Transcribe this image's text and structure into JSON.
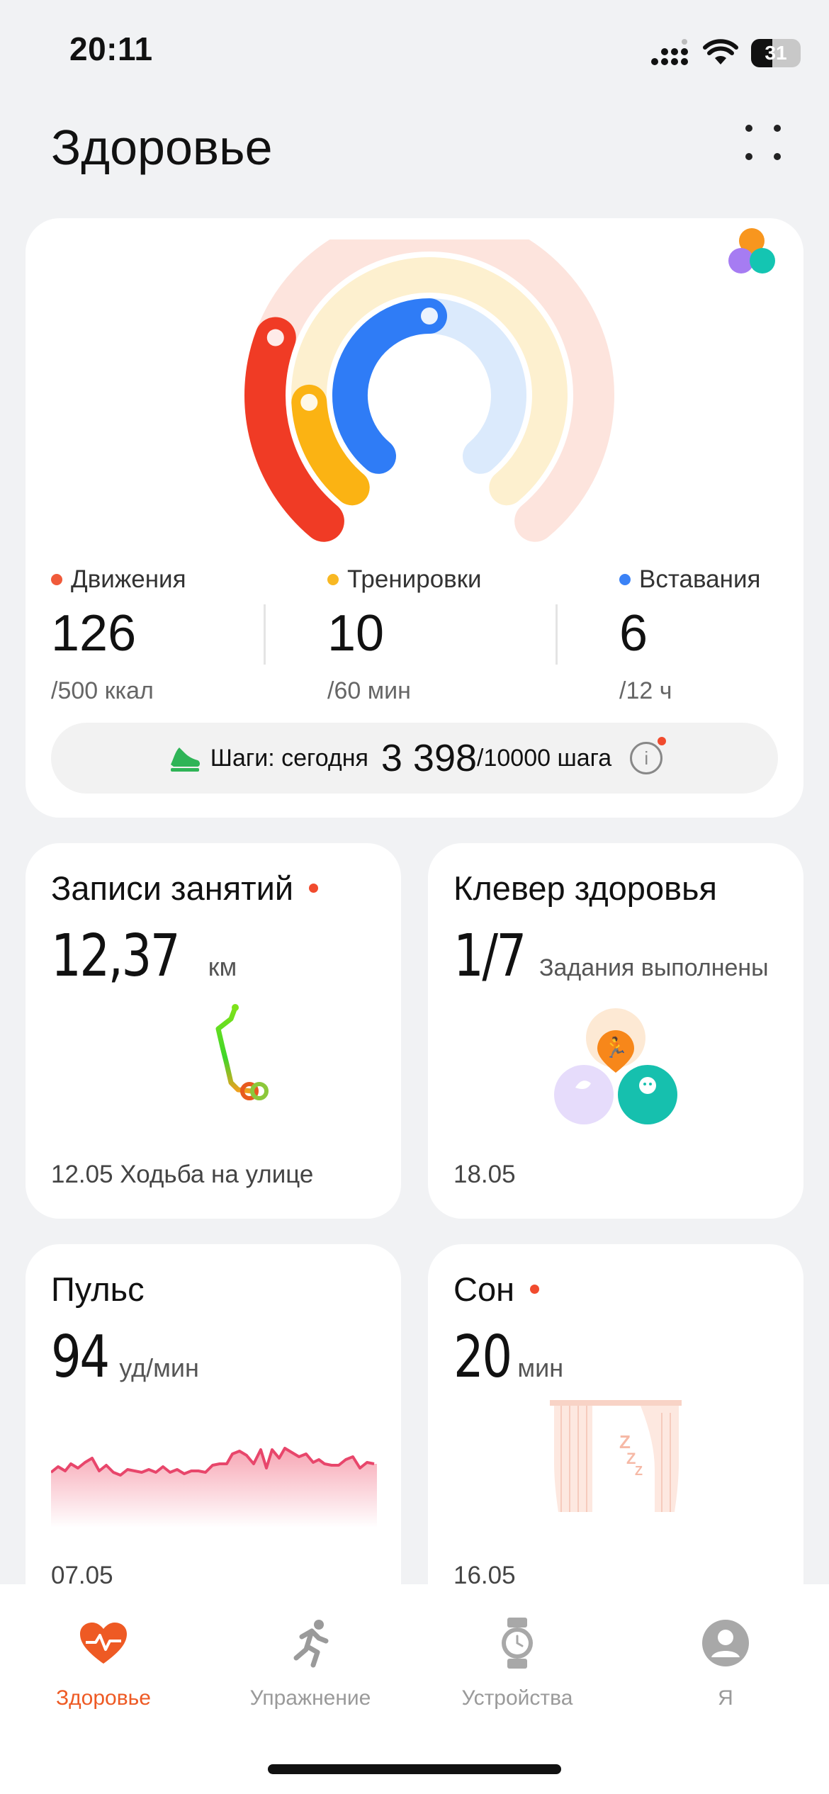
{
  "status_bar": {
    "time": "20:11",
    "battery": "31"
  },
  "page": {
    "title": "Здоровье"
  },
  "activity": {
    "rings": [
      {
        "name": "Движения",
        "value": 126,
        "goal": 500,
        "color": "#f03b25"
      },
      {
        "name": "Тренировки",
        "value": 10,
        "goal": 60,
        "color": "#fbb313"
      },
      {
        "name": "Вставания",
        "value": 6,
        "goal": 12,
        "color": "#2f7cf6"
      }
    ],
    "metrics": [
      {
        "label": "Движения",
        "value": "126",
        "goal": "/500 ккал",
        "color": "#f05a3a"
      },
      {
        "label": "Тренировки",
        "value": "10",
        "goal": "/60 мин",
        "color": "#f8b823"
      },
      {
        "label": "Вставания",
        "value": "6",
        "goal": "/12 ч",
        "color": "#3b82f6"
      }
    ],
    "steps": {
      "label": "Шаги: сегодня",
      "value": "3 398",
      "goal": "/10000 шага"
    }
  },
  "cards": {
    "workouts": {
      "title": "Записи занятий",
      "value": "12,37",
      "unit": "км",
      "footer": "12.05 Ходьба на улице"
    },
    "clover": {
      "title": "Клевер здоровья",
      "value": "1/7",
      "unit": "Задания выполнены",
      "footer": "18.05"
    },
    "pulse": {
      "title": "Пульс",
      "value": "94",
      "unit": "уд/мин",
      "footer": "07.05"
    },
    "sleep": {
      "title": "Сон",
      "value": "20",
      "unit": "мин",
      "footer": "16.05"
    }
  },
  "tabbar": {
    "items": [
      {
        "label": "Здоровье",
        "icon": "heart-pulse-icon",
        "active": true
      },
      {
        "label": "Упражнение",
        "icon": "running-icon",
        "active": false
      },
      {
        "label": "Устройства",
        "icon": "watch-icon",
        "active": false
      },
      {
        "label": "Я",
        "icon": "profile-icon",
        "active": false
      }
    ]
  },
  "colors": {
    "accent": "#ee5a24",
    "move": "#f03b25",
    "exercise": "#fbb313",
    "stand": "#2f7cf6"
  }
}
